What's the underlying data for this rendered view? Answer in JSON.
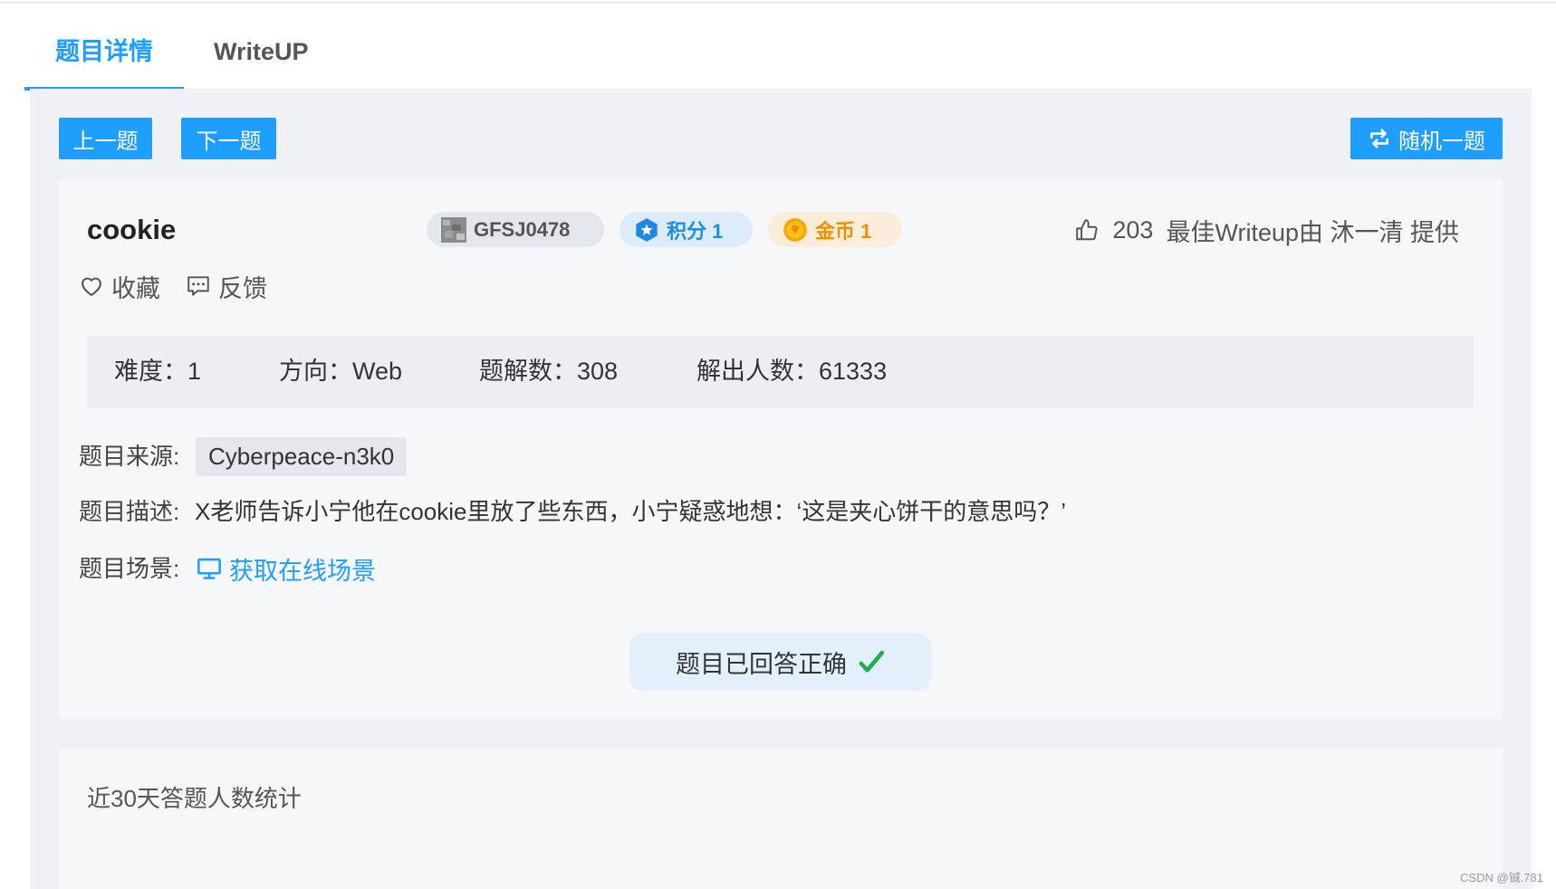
{
  "tabs": {
    "details": "题目详情",
    "writeup": "WriteUP",
    "active": "details"
  },
  "nav": {
    "prev": "上一题",
    "next": "下一题",
    "random": "随机一题"
  },
  "challenge": {
    "title": "cookie",
    "code": "GFSJ0478",
    "score": "积分 1",
    "coins": "金币 1",
    "likes": "203",
    "writeup_credit": "最佳Writeup由 沐一清 提供",
    "favorite": "收藏",
    "feedback": "反馈",
    "stats": {
      "difficulty_label": "难度：",
      "difficulty": "1",
      "category_label": "方向：",
      "category": "Web",
      "writeups_label": "题解数：",
      "writeups": "308",
      "solvers_label": "解出人数：",
      "solvers": "61333"
    },
    "source_label": "题目来源:",
    "source": "Cyberpeace-n3k0",
    "description_label": "题目描述:",
    "description": "X老师告诉小宁他在cookie里放了些东西，小宁疑惑地想：‘这是夹心饼干的意思吗？’",
    "scene_label": "题目场景:",
    "scene_link": "获取在线场景",
    "status": "题目已回答正确"
  },
  "stats_section": {
    "title": "近30天答题人数统计"
  },
  "watermark": "CSDN @铖.781",
  "colors": {
    "accent": "#1e9fff",
    "success": "#1fae4a",
    "coin": "#f29100",
    "panel": "#eff1f4"
  },
  "icons": {
    "random": "swap-icon",
    "code": "challenge-thumbnail-icon",
    "score": "score-hexagon-icon",
    "coins": "gold-coin-icon",
    "likes": "thumbs-up-icon",
    "favorite": "heart-icon",
    "feedback": "chat-bubble-icon",
    "scene": "monitor-icon",
    "status": "checkmark-icon"
  }
}
